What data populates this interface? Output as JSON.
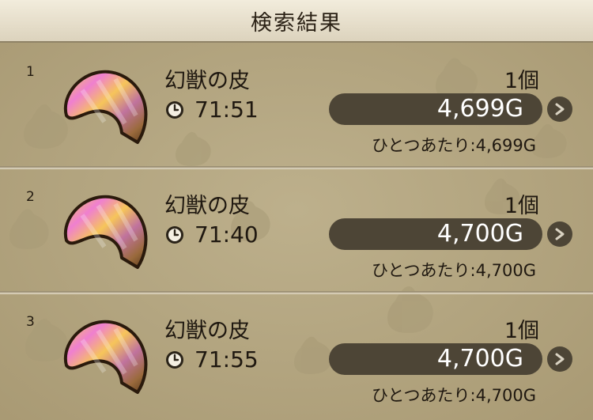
{
  "header": {
    "title": "検索結果"
  },
  "results": [
    {
      "index": "1",
      "name": "幻獣の皮",
      "time": "71:51",
      "quantity": "1個",
      "price": "4,699G",
      "unit_price": "ひとつあたり:4,699G"
    },
    {
      "index": "2",
      "name": "幻獣の皮",
      "time": "71:40",
      "quantity": "1個",
      "price": "4,700G",
      "unit_price": "ひとつあたり:4,700G"
    },
    {
      "index": "3",
      "name": "幻獣の皮",
      "time": "71:55",
      "quantity": "1個",
      "price": "4,700G",
      "unit_price": "ひとつあたり:4,700G"
    }
  ],
  "icons": {
    "item": "hide-leather-icon",
    "timer": "clock-icon",
    "detail": "chevron-right-icon"
  },
  "colors": {
    "background": "#b7a985",
    "header": "#ece5d3",
    "pill": "#4d4536",
    "text": "#1f1810",
    "price_text": "#ffffff"
  }
}
